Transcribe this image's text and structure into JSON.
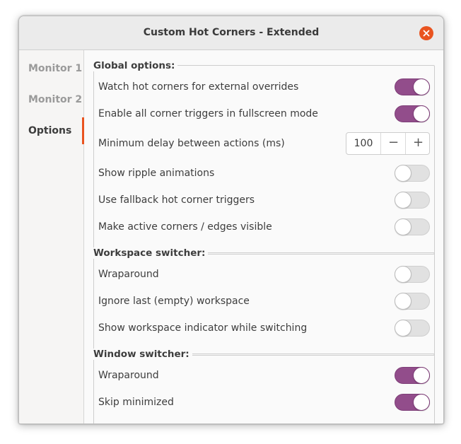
{
  "window": {
    "title": "Custom Hot Corners - Extended"
  },
  "sidebar": {
    "items": [
      {
        "label": "Monitor 1",
        "active": false
      },
      {
        "label": "Monitor 2",
        "active": false
      },
      {
        "label": "Options",
        "active": true
      }
    ]
  },
  "colors": {
    "accent": "#e95420",
    "switch_on": "#924d8b",
    "switch_off": "#e1e1e1"
  },
  "global": {
    "title": "Global options:",
    "watch_label": "Watch hot corners for external overrides",
    "watch_on": true,
    "fullscreen_label": "Enable all corner triggers in fullscreen mode",
    "fullscreen_on": true,
    "delay_label": "Minimum delay between actions (ms)",
    "delay_value": "100",
    "delay_minus": "−",
    "delay_plus": "+",
    "ripple_label": "Show ripple animations",
    "ripple_on": false,
    "fallback_label": "Use fallback hot corner triggers",
    "fallback_on": false,
    "visible_label": "Make active corners / edges visible",
    "visible_on": false
  },
  "workspace": {
    "title": "Workspace switcher:",
    "wrap_label": "Wraparound",
    "wrap_on": false,
    "ignore_label": "Ignore last (empty) workspace",
    "ignore_on": false,
    "indicator_label": "Show workspace indicator while switching",
    "indicator_on": false
  },
  "window_switcher": {
    "title": "Window switcher:",
    "wrap_label": "Wraparound",
    "wrap_on": true,
    "skip_label": "Skip minimized",
    "skip_on": true
  }
}
